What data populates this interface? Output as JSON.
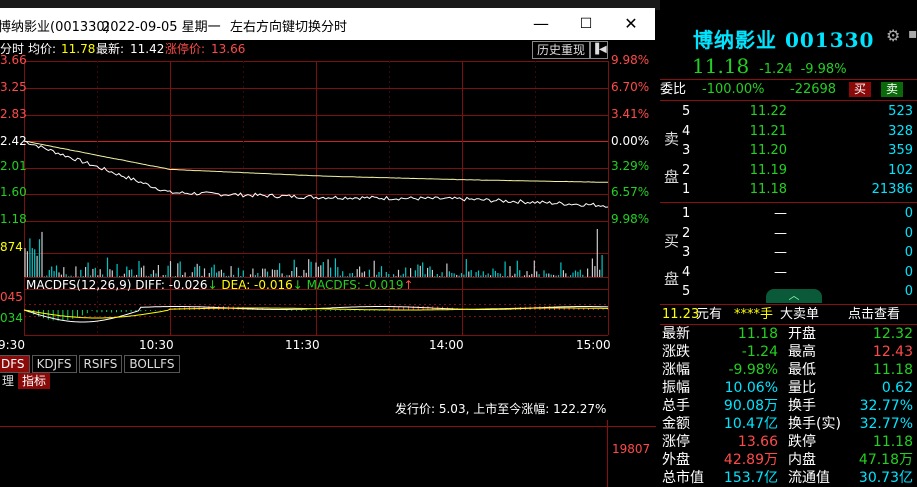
{
  "popup": {
    "title": "博纳影业(001330)",
    "date": "2022-09-05 星期一",
    "hint": "左右方向键切换分时",
    "minimize": "—",
    "maximize": "☐",
    "close": "✕",
    "info": {
      "label": "分时",
      "avg_label": "均价:",
      "avg": "11.78",
      "last_label": "最新:",
      "last": "11.42",
      "limit_label": "涨停价:",
      "limit": "13.66"
    },
    "history_button": "历史重现",
    "price_axis": [
      "3.66",
      "3.25",
      "2.83",
      "2.42",
      "2.01",
      "1.60",
      "1.18"
    ],
    "pct_axis": [
      "9.98%",
      "6.70%",
      "3.41%",
      "0.00%",
      "3.29%",
      "6.57%",
      "9.98%"
    ],
    "volume_label": "874",
    "macd": {
      "name": "MACDFS(12,26,9)",
      "diff": "DIFF: -0.026",
      "dea": "DEA: -0.016",
      "macd": "MACDFS: -0.019",
      "arrow_down": "↓",
      "arrow_up": "↑",
      "axis_top": "045",
      "axis_mid": "034"
    },
    "time_axis": [
      "9:30",
      "10:30",
      "11:30",
      "14:00",
      "15:00"
    ],
    "tabs": [
      "DFS",
      "KDJFS",
      "RSIFS",
      "BOLLFS"
    ],
    "subtabs": [
      "理",
      "指标"
    ],
    "ipo_text": "发行价: 5.03, 上市至今涨幅: 122.27%",
    "bottom_number": "19807"
  },
  "chart_data": {
    "type": "line",
    "title": "",
    "x": [
      "9:30",
      "10:30",
      "11:30",
      "14:00",
      "15:00"
    ],
    "series": [
      {
        "name": "最新",
        "values": [
          12.42,
          11.62,
          11.55,
          11.52,
          11.42
        ]
      },
      {
        "name": "均价",
        "values": [
          12.42,
          11.98,
          11.88,
          11.82,
          11.78
        ]
      }
    ],
    "ylim": [
      11.18,
      13.66
    ]
  },
  "right_panel": {
    "name": "博纳影业",
    "code": "001330",
    "price": "11.18",
    "change": "-1.24",
    "pct": "-9.98%",
    "wb_label": "委比",
    "wb_pct": "-100.00%",
    "wb_diff": "-22698",
    "buy_btn": "买",
    "sell_btn": "卖",
    "sell_side_label": [
      "卖",
      "盘"
    ],
    "buy_side_label": [
      "买",
      "盘"
    ],
    "asks": [
      {
        "level": "5",
        "price": "11.22",
        "vol": "523"
      },
      {
        "level": "4",
        "price": "11.21",
        "vol": "328"
      },
      {
        "level": "3",
        "price": "11.20",
        "vol": "359"
      },
      {
        "level": "2",
        "price": "11.19",
        "vol": "102"
      },
      {
        "level": "1",
        "price": "11.18",
        "vol": "21386"
      }
    ],
    "bids": [
      {
        "level": "1",
        "price": "—",
        "vol": "0"
      },
      {
        "level": "2",
        "price": "—",
        "vol": "0"
      },
      {
        "level": "3",
        "price": "—",
        "vol": "0"
      },
      {
        "level": "4",
        "price": "—",
        "vol": "0"
      },
      {
        "level": "5",
        "price": "—",
        "vol": "0"
      }
    ],
    "bigorder": {
      "price": "11.23",
      "text1": "元有",
      "stars": "****手",
      "text2": "大卖单",
      "link": "点击查看"
    },
    "stats": [
      {
        "l1": "最新",
        "v1": "11.18",
        "c1": "grn",
        "l2": "开盘",
        "v2": "12.32",
        "c2": "grn"
      },
      {
        "l1": "涨跌",
        "v1": "-1.24",
        "c1": "grn",
        "l2": "最高",
        "v2": "12.43",
        "c2": "red"
      },
      {
        "l1": "涨幅",
        "v1": "-9.98%",
        "c1": "grn",
        "l2": "最低",
        "v2": "11.18",
        "c2": "grn"
      },
      {
        "l1": "振幅",
        "v1": "10.06%",
        "c1": "cyan",
        "l2": "量比",
        "v2": "0.62",
        "c2": "cyan"
      },
      {
        "l1": "总手",
        "v1": "90.08万",
        "c1": "cyan",
        "l2": "换手",
        "v2": "32.77%",
        "c2": "cyan"
      },
      {
        "l1": "金额",
        "v1": "10.47亿",
        "c1": "cyan",
        "l2": "换手(实)",
        "v2": "32.77%",
        "c2": "cyan"
      },
      {
        "l1": "涨停",
        "v1": "13.66",
        "c1": "red",
        "l2": "跌停",
        "v2": "11.18",
        "c2": "grn"
      },
      {
        "l1": "外盘",
        "v1": "42.89万",
        "c1": "red",
        "l2": "内盘",
        "v2": "47.18万",
        "c2": "grn"
      },
      {
        "l1": "总市值",
        "v1": "153.7亿",
        "c1": "cyan",
        "l2": "流通值",
        "v2": "30.73亿",
        "c2": "cyan"
      }
    ]
  }
}
